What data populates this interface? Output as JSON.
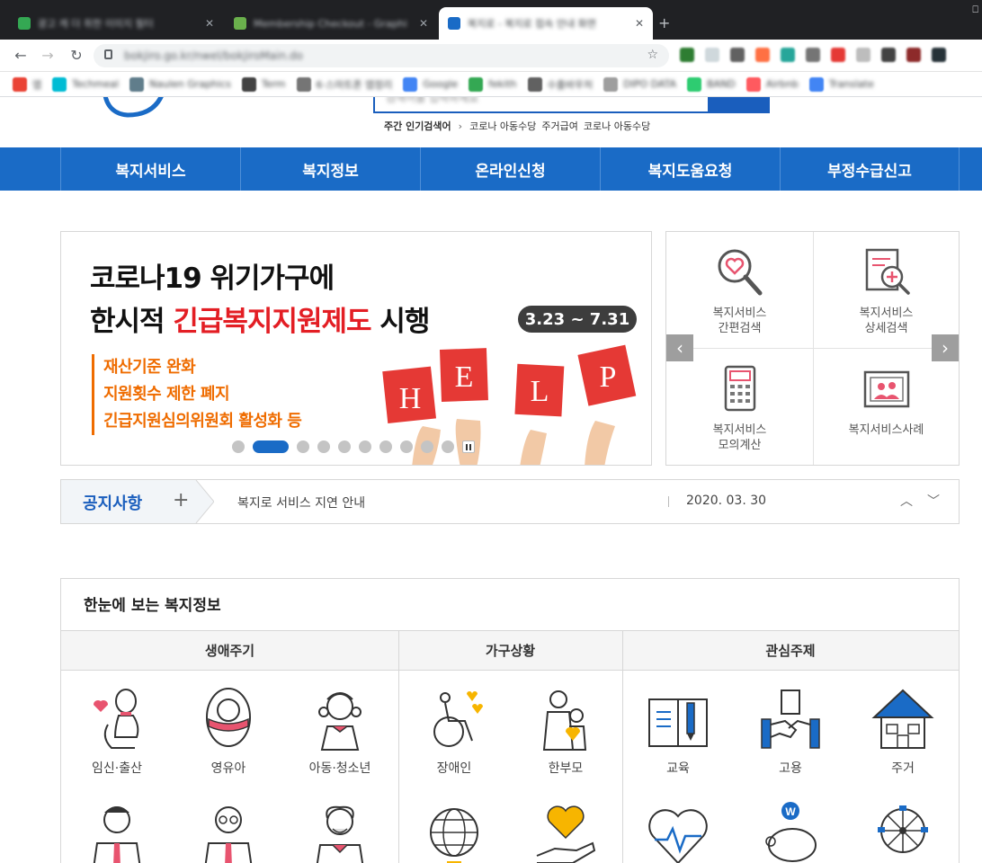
{
  "browser": {
    "tabs": [
      {
        "title": "광고 캐 더 취한 이미지 필터",
        "active": false,
        "fav_color": "#34a853"
      },
      {
        "title": "Membership Checkout - Graphi",
        "active": false,
        "fav_color": "#6ab04c"
      },
      {
        "title": "복지로 - 복지로 접속 안내 화면",
        "active": true,
        "fav_color": "#1a6bc6"
      }
    ],
    "new_tab": "+",
    "window_control": "⎕",
    "address": "bokjiro.go.kr/nwel/bokjiroMain.do",
    "bookmarks": [
      {
        "label": "앱",
        "color": "#ea4335"
      },
      {
        "label": "Techmeal",
        "color": "#00bcd4"
      },
      {
        "label": "Naulen Graphics",
        "color": "#607d8b"
      },
      {
        "label": "Term",
        "color": "#424242"
      },
      {
        "label": "6·스마트폰 앱정리",
        "color": "#757575"
      },
      {
        "label": "Google",
        "color": "#4285f4"
      },
      {
        "label": "fekith",
        "color": "#34a853"
      },
      {
        "label": "수출바우처",
        "color": "#616161"
      },
      {
        "label": "DIPO DATA",
        "color": "#9e9e9e"
      },
      {
        "label": "BAND",
        "color": "#2ecc71"
      },
      {
        "label": "Airbnb",
        "color": "#ff5a5f"
      },
      {
        "label": "Translate",
        "color": "#4285f4"
      }
    ]
  },
  "header": {
    "search_placeholder": "검색어를 입력하세요",
    "popular_head": "주간 인기검색어",
    "popular_arrow": "›",
    "popular_terms": [
      "코로나 아동수당",
      "주거급여",
      "코로나 아동수당"
    ]
  },
  "gnb": [
    "복지서비스",
    "복지정보",
    "온라인신청",
    "복지도움요청",
    "부정수급신고"
  ],
  "banner": {
    "line1": "코로나19 위기가구에",
    "line2_pre": "한시적 ",
    "line2_red": "긴급복지지원제도",
    "line2_post": " 시행",
    "date": "3.23 ~ 7.31",
    "points": [
      "재산기준 완화",
      "지원횟수 제한 폐지",
      "긴급지원심의위원회 활성화 등"
    ],
    "help_letters": [
      "H",
      "E",
      "L",
      "P"
    ],
    "accent_red": "#e53935",
    "accent_orange": "#ef6c00",
    "slide_count": 11,
    "active_slide": 2
  },
  "quick": {
    "items": [
      {
        "label": "복지서비스\n간편검색",
        "icon": "heart-search-icon"
      },
      {
        "label": "복지서비스\n상세검색",
        "icon": "document-search-icon"
      },
      {
        "label": "복지서비스\n모의계산",
        "icon": "calculator-icon"
      },
      {
        "label": "복지서비스사례",
        "icon": "picture-frame-icon"
      }
    ],
    "prev": "‹",
    "next": "›"
  },
  "notice": {
    "title": "공지사항",
    "plus": "+",
    "text": "복지로 서비스 지연 안내",
    "date": "2020. 03. 30",
    "up": "︿",
    "down": "﹀"
  },
  "welfare_info": {
    "title": "한눈에 보는 복지정보",
    "columns": [
      "생애주기",
      "가구상황",
      "관심주제"
    ],
    "row1": [
      {
        "label": "임신·출산",
        "icon": "pregnant-woman-icon"
      },
      {
        "label": "영유아",
        "icon": "baby-icon"
      },
      {
        "label": "아동·청소년",
        "icon": "child-icon"
      },
      {
        "label": "장애인",
        "icon": "wheelchair-icon"
      },
      {
        "label": "한부모",
        "icon": "single-parent-icon"
      },
      {
        "label": "교육",
        "icon": "book-pencil-icon"
      },
      {
        "label": "고용",
        "icon": "handshake-icon"
      },
      {
        "label": "주거",
        "icon": "house-icon"
      }
    ],
    "row2_icons": [
      "adult-man-icon",
      "middle-aged-man-icon",
      "elderly-man-icon",
      "globe-icon",
      "heart-hand-icon",
      "heartbeat-icon",
      "piggy-bank-icon",
      "ferris-wheel-icon"
    ],
    "brand_blue": "#1a6bc6"
  }
}
